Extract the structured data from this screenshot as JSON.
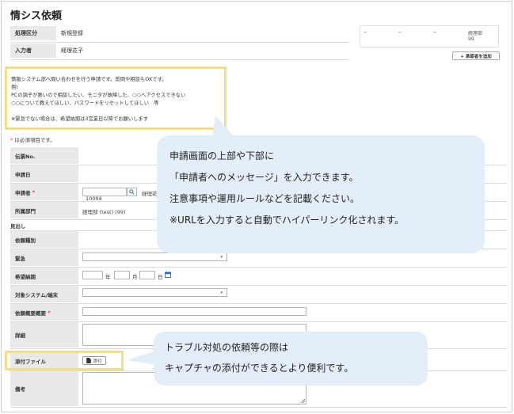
{
  "page": {
    "title": "情シス依頼"
  },
  "header_fields": [
    {
      "label": "処理区分",
      "value": "新規登録"
    },
    {
      "label": "入力者",
      "value": "経理花子"
    }
  ],
  "approval": {
    "cells": [
      "--",
      "--",
      "--",
      "経理部"
    ],
    "last_number": "99",
    "add_button": "+ 承認者を追加"
  },
  "message": {
    "lines": [
      "情報システム部へ問い合わせを行う申請です。質問や相談もOKです。",
      "例)",
      "PCの調子が悪いので相談したい、モニタが故障した、○○へアクセスできない",
      "○○について教えてほしい、パスワードをリセットしてほしい　等",
      "",
      "※緊急でない場合は、希望納期は3営業日以降でお願いします"
    ]
  },
  "required_note": {
    "star": "*",
    "text": " は必須項目です。"
  },
  "form": {
    "denpyo_label": "伝票No.",
    "date_label": "申請日",
    "applicant_label": "申請者",
    "applicant_code": "10004",
    "applicant_name": "経理花",
    "dept_label": "所属部門",
    "dept_value": "経理部 (test) (99)",
    "section_heading": "見出し",
    "type_label": "依頼種別",
    "urgent_label": "緊急",
    "due_label": "希望納期",
    "year": "年",
    "month": "月",
    "day": "日",
    "system_label": "対象システム/端末",
    "summary_label": "依頼概要概要",
    "detail_label": "詳細",
    "attach_label": "添付ファイル",
    "attach_button": "添付",
    "remarks_label": "備考"
  },
  "callout_top": {
    "lines": [
      "申請画面の上部や下部に",
      "「申請者へのメッセージ」を入力できます。",
      "注意事項や運用ルールなどを記載ください。",
      "※URLを入力すると自動でハイパーリンク化されます。"
    ]
  },
  "callout_bottom": {
    "lines": [
      "トラブル対処の依頼等の際は",
      "キャプチャの添付ができるとより便利です。"
    ]
  },
  "colors": {
    "highlight": "#f1e08a",
    "callout": "#e3eef8",
    "label_bg": "#e9e9e9",
    "required": "#e34444"
  },
  "icons": [
    "search-icon",
    "calendar-icon",
    "chevron-down-icon",
    "file-icon",
    "resize-grip-icon"
  ]
}
